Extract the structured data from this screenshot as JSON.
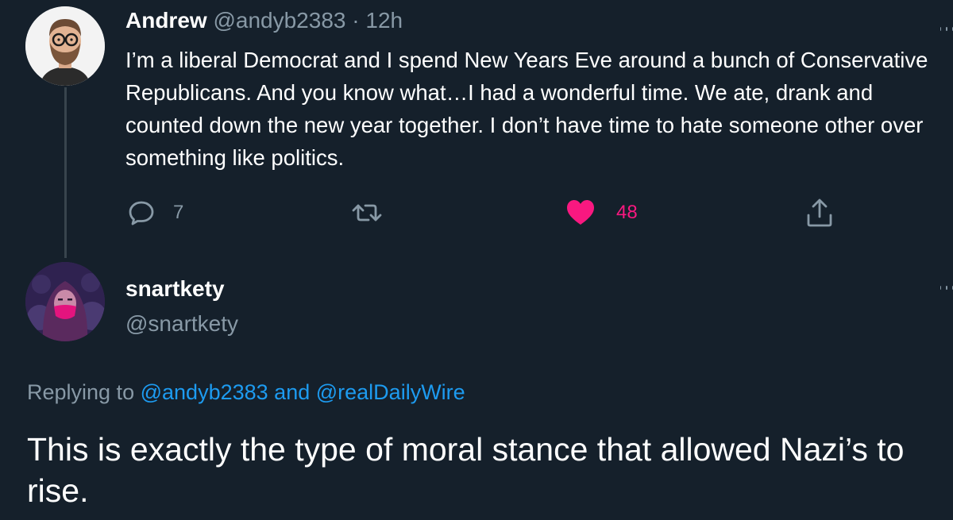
{
  "tweet1": {
    "name": "Andrew",
    "handle": "@andyb2383",
    "separator": "·",
    "time": "12h",
    "text": "I’m a liberal Democrat and I spend New Years Eve around a bunch of Conservative Republicans.  And you know what…I had a wonderful time.  We ate, drank and counted down the new year together.  I don’t have time to hate someone other over something like politics.",
    "actions": {
      "reply_icon": "reply-icon",
      "reply_count": "7",
      "retweet_icon": "retweet-icon",
      "like_icon": "heart-icon",
      "like_count": "48",
      "share_icon": "share-icon"
    },
    "like_color": "#f91880"
  },
  "tweet2": {
    "name": "snartkety",
    "handle": "@snartkety",
    "replying_prefix": "Replying to",
    "replying_user1": "@andyb2383",
    "replying_and": "and",
    "replying_user2": "@realDailyWire",
    "text": "This is exactly the type of moral stance that allowed Nazi’s to rise."
  },
  "colors": {
    "background": "#15202b",
    "secondary_text": "#8899a6",
    "link": "#1d9bf0",
    "thread_line": "#38444d"
  }
}
